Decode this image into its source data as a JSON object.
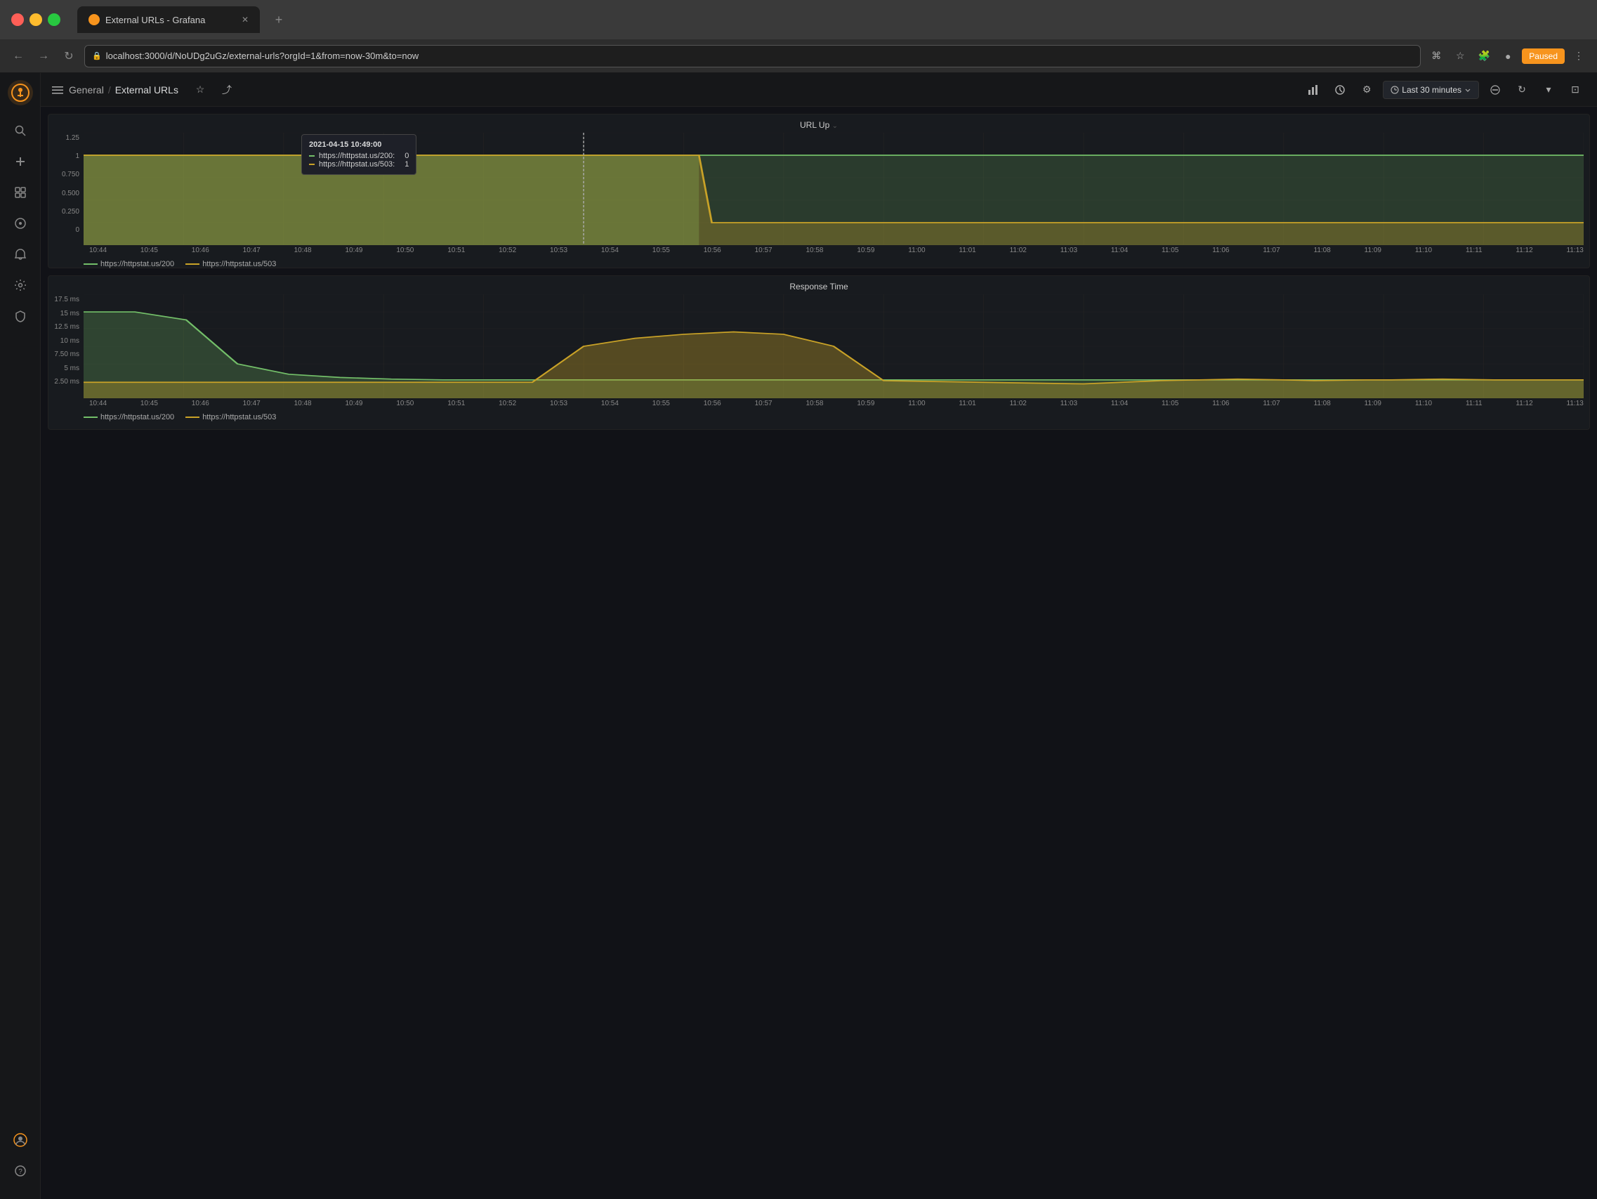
{
  "browser": {
    "tab_title": "External URLs - Grafana",
    "url": "localhost:3000/d/NoUDg2uGz/external-urls?orgId=1&from=now-30m&to=now",
    "favicon": "G",
    "paused_label": "Paused"
  },
  "app": {
    "breadcrumb_parent": "General",
    "breadcrumb_separator": "/",
    "breadcrumb_current": "External URLs"
  },
  "nav": {
    "time_range": "Last 30 minutes"
  },
  "panels": {
    "url_up": {
      "title": "URL Up",
      "y_axis": [
        "1.25",
        "1",
        "0.750",
        "0.500",
        "0.250",
        "0"
      ],
      "x_axis": [
        "10:44",
        "10:45",
        "10:46",
        "10:47",
        "10:48",
        "10:49",
        "10:50",
        "10:51",
        "10:52",
        "10:53",
        "10:54",
        "10:55",
        "10:56",
        "10:57",
        "10:58",
        "10:59",
        "11:00",
        "11:01",
        "11:02",
        "11:03",
        "11:04",
        "11:05",
        "11:06",
        "11:07",
        "11:08",
        "11:09",
        "11:10",
        "11:11",
        "11:12",
        "11:13"
      ],
      "legend": [
        {
          "label": "https://httpstat.us/200",
          "color_class": "legend-line-green"
        },
        {
          "label": "https://httpstat.us/503",
          "color_class": "legend-line-yellow"
        }
      ],
      "tooltip": {
        "title": "2021-04-15 10:49:00",
        "rows": [
          {
            "label": "https://httpstat.us/200:",
            "value": "0",
            "color": "green"
          },
          {
            "label": "https://httpstat.us/503:",
            "value": "1",
            "color": "yellow"
          }
        ]
      }
    },
    "response_time": {
      "title": "Response Time",
      "y_axis": [
        "17.5 ms",
        "15 ms",
        "12.5 ms",
        "10 ms",
        "7.50 ms",
        "5 ms",
        "2.50 ms"
      ],
      "x_axis": [
        "10:44",
        "10:45",
        "10:46",
        "10:47",
        "10:48",
        "10:49",
        "10:50",
        "10:51",
        "10:52",
        "10:53",
        "10:54",
        "10:55",
        "10:56",
        "10:57",
        "10:58",
        "10:59",
        "11:00",
        "11:01",
        "11:02",
        "11:03",
        "11:04",
        "11:05",
        "11:06",
        "11:07",
        "11:08",
        "11:09",
        "11:10",
        "11:11",
        "11:12",
        "11:13"
      ],
      "legend": [
        {
          "label": "https://httpstat.us/200",
          "color_class": "legend-line-green"
        },
        {
          "label": "https://httpstat.us/503",
          "color_class": "legend-line-yellow"
        }
      ]
    }
  },
  "sidebar": {
    "items": [
      {
        "name": "search",
        "icon": "🔍"
      },
      {
        "name": "add",
        "icon": "+"
      },
      {
        "name": "dashboards",
        "icon": "⊞"
      },
      {
        "name": "explore",
        "icon": "⊙"
      },
      {
        "name": "alerting",
        "icon": "🔔"
      },
      {
        "name": "settings",
        "icon": "⚙"
      },
      {
        "name": "shield",
        "icon": "🛡"
      }
    ],
    "bottom": [
      {
        "name": "user",
        "icon": "👤"
      },
      {
        "name": "help",
        "icon": "?"
      }
    ]
  }
}
